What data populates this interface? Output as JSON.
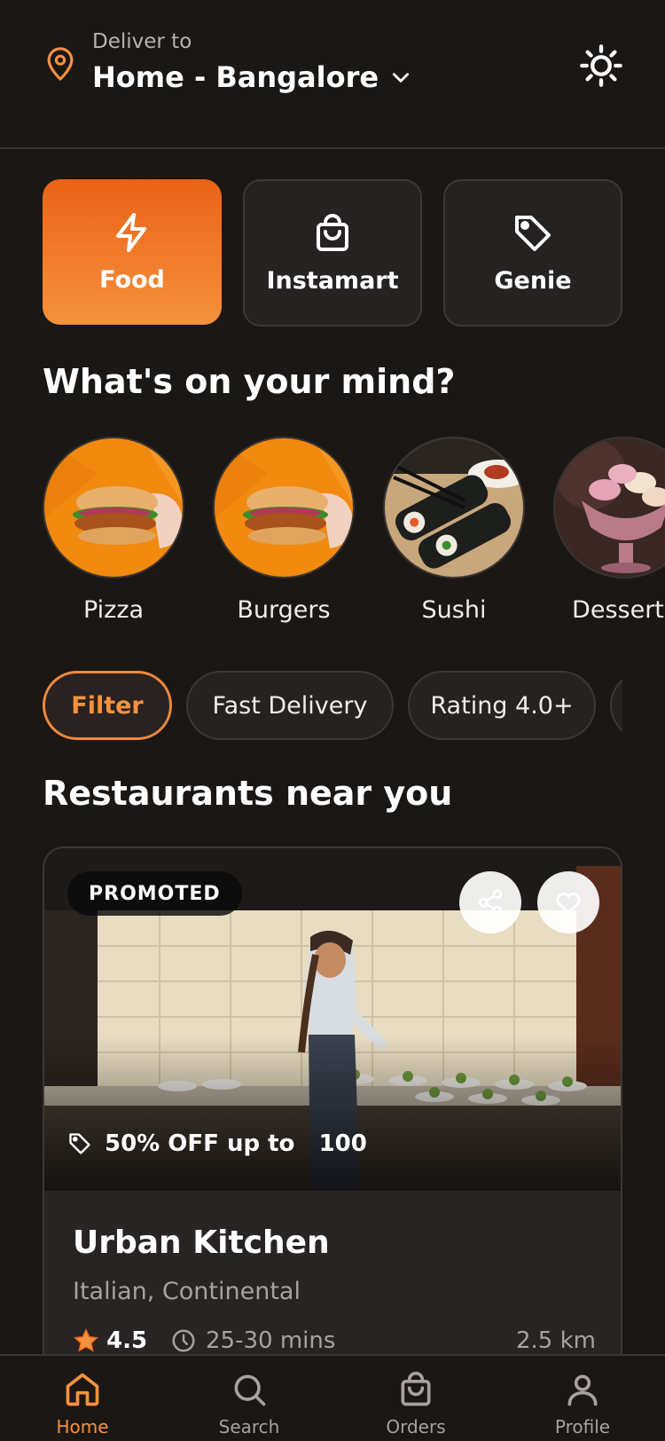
{
  "header": {
    "deliver_label": "Deliver to",
    "address": "Home - Bangalore"
  },
  "categories": [
    {
      "label": "Food",
      "icon": "lightning-icon",
      "active": true
    },
    {
      "label": "Instamart",
      "icon": "shopping-bag-icon",
      "active": false
    },
    {
      "label": "Genie",
      "icon": "tag-icon",
      "active": false
    }
  ],
  "mind_section": {
    "title": "What's on your mind?",
    "items": [
      {
        "label": "Pizza"
      },
      {
        "label": "Burgers"
      },
      {
        "label": "Sushi"
      },
      {
        "label": "Desserts"
      }
    ]
  },
  "filters": [
    {
      "label": "Filter",
      "active": true
    },
    {
      "label": "Fast Delivery"
    },
    {
      "label": "Rating 4.0+"
    }
  ],
  "restaurants_section": {
    "title": "Restaurants near you",
    "card": {
      "badge": "PROMOTED",
      "offer": "50% OFF up to   100",
      "name": "Urban Kitchen",
      "cuisine": "Italian, Continental",
      "rating": "4.5",
      "time": "25-30 mins",
      "distance": "2.5 km"
    }
  },
  "bottom_nav": [
    {
      "label": "Home",
      "icon": "home-icon",
      "active": true
    },
    {
      "label": "Search",
      "icon": "search-icon"
    },
    {
      "label": "Orders",
      "icon": "shopping-bag-icon"
    },
    {
      "label": "Profile",
      "icon": "user-icon"
    }
  ],
  "colors": {
    "background": "#1b1715",
    "accent": "#f5913d",
    "accent_dark": "#eb6216",
    "surface": "#262221",
    "muted_text": "#a9a19c"
  }
}
